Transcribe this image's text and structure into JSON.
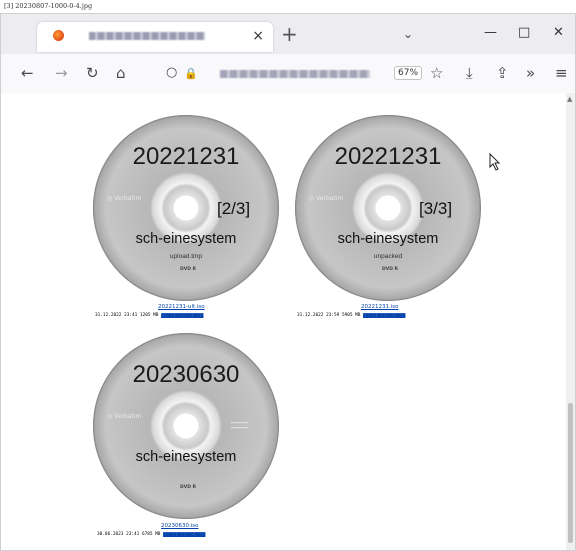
{
  "caption": "[3] 20230807-1000-0-4.jpg",
  "tab": {
    "close": "×"
  },
  "toolbar": {
    "new_tab": "+",
    "tab_list": "⌄",
    "minimize": "—",
    "maximize": "□",
    "close": "✕"
  },
  "nav": {
    "back": "←",
    "forward": "→",
    "reload": "↻",
    "home": "⌂",
    "reader": "○",
    "tracking": "🔒",
    "zoom": "67%",
    "bookmark": "☆",
    "downloads": "⤓",
    "extensions": "⇪",
    "overflow": "»",
    "menu": "≡"
  },
  "discs": [
    {
      "date": "20221231",
      "part": "[2/3]",
      "name": "sch-einesystem",
      "sub": "upload.tmp",
      "link": "20221231-ult.iso",
      "meta_prefix": "31.12.2022 23:41 1205 MB"
    },
    {
      "date": "20221231",
      "part": "[3/3]",
      "name": "sch-einesystem",
      "sub": "unpacked",
      "link": "20221231.iso",
      "meta_prefix": "31.12.2022 23:59 5905 MB"
    },
    {
      "date": "20230630",
      "part": "",
      "name": "sch-einesystem",
      "sub": "",
      "link": "20230630.iso",
      "meta_prefix": "30.06.2023 23:41 6785 MB"
    }
  ]
}
